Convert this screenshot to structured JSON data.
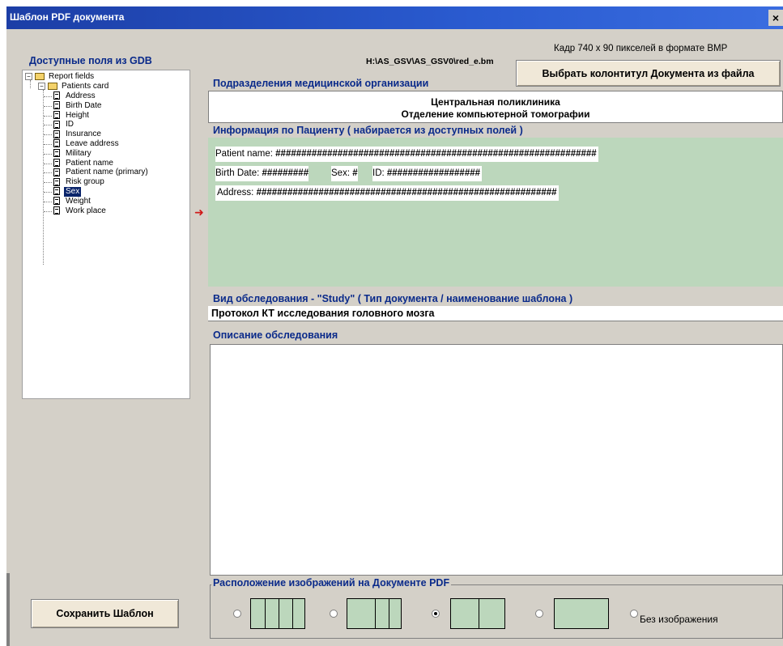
{
  "window": {
    "title": "Шаблон PDF документа",
    "close_label": "×"
  },
  "left_panel": {
    "heading": "Доступные поля из GDB",
    "tree": {
      "root": "Report fields",
      "group": "Patients card",
      "items": [
        "Address",
        "Birth Date",
        "Height",
        "ID",
        "Insurance",
        "Leave address",
        "Military",
        "Patient name",
        "Patient name (primary)",
        "Risk group",
        "Sex",
        "Weight",
        "Work place"
      ],
      "selected": "Sex"
    },
    "save_button": "Сохранить Шаблон"
  },
  "header": {
    "path": "H:\\AS_GSV\\AS_GSV0\\red_e.bm",
    "frame_info": "Кадр 740 x 90 пикселей в формате BMP",
    "choose_button": "Выбрать колонтитул Документа из файла"
  },
  "divisions": {
    "label": "Подразделения медицинской  организации",
    "line1": "Центральная поликлиника",
    "line2": "Отделение компьютерной томографии"
  },
  "patient_info": {
    "label": "Информация по Пациенту  ( набирается из доступных полей )",
    "name_label": "Patient name: ",
    "name_value": "##############################################################",
    "birth_label": "Birth Date: ",
    "birth_value": "#########",
    "sex_label": "Sex: ",
    "sex_value": "#",
    "id_label": "ID: ",
    "id_value": "##################",
    "address_label": "Address: ",
    "address_value": "##########################################################"
  },
  "study": {
    "label": "Вид обследования - \"Study\"  ( Тип документа / наименование шаблона )",
    "value": "Протокол КТ исследования головного мозга"
  },
  "description": {
    "label": "Описание обследования",
    "value": ""
  },
  "image_layout": {
    "label": "Расположение изображений на Документе PDF",
    "options": [
      {
        "name": "layout-4",
        "cells": 4,
        "selected": false
      },
      {
        "name": "layout-3",
        "cells": 3,
        "selected": false
      },
      {
        "name": "layout-2",
        "cells": 2,
        "selected": true
      },
      {
        "name": "layout-1",
        "cells": 1,
        "selected": false
      }
    ],
    "no_image_label": "Без изображения",
    "no_image_selected": false
  },
  "colors": {
    "title_bar": "#1c4bb6",
    "green_panel": "#bcd7bc",
    "label_blue": "#0a2a8a",
    "button_face": "#f0e8d8"
  }
}
